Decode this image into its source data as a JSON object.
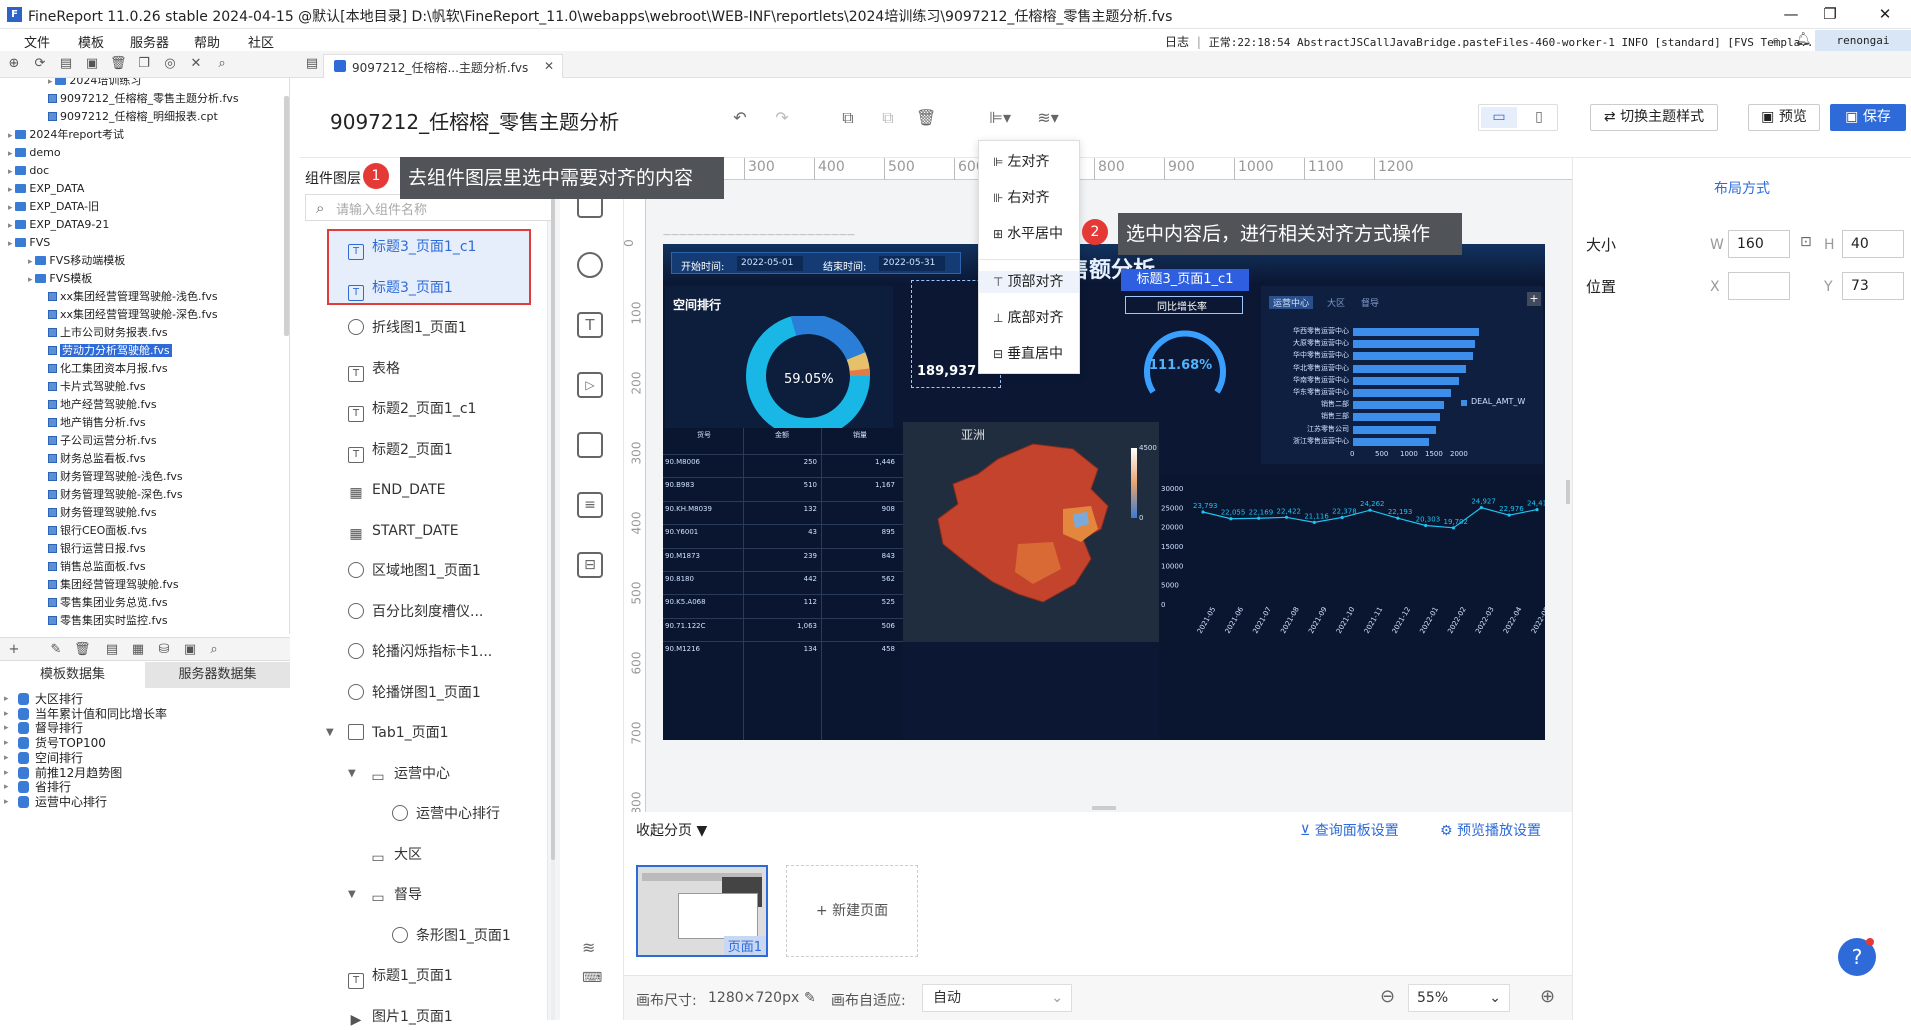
{
  "window": {
    "title": "FineReport 11.0.26 stable 2024-04-15 @默认[本地目录]    D:\\帆软\\FineReport_11.0\\webapps\\webroot\\WEB-INF\\reportlets\\2024培训练习\\9097212_任榕榕_零售主题分析.fvs"
  },
  "menu": [
    "文件",
    "模板",
    "服务器",
    "帮助",
    "社区"
  ],
  "status": {
    "log_label": "日志",
    "text": "正常:22:18:54 AbstractJSCallJavaBridge.pasteFiles-460-worker-1 INFO [standard] [FVS Templa...",
    "user": "renongai"
  },
  "tab": {
    "label": "9097212_任榕榕...主题分析.fvs"
  },
  "file_tree": [
    {
      "label": "2024培训练习",
      "kind": "folder"
    },
    {
      "label": "9097212_任榕榕_零售主题分析.fvs",
      "kind": "file"
    },
    {
      "label": "9097212_任榕榕_明细报表.cpt",
      "kind": "file"
    },
    {
      "label": "2024年report考试",
      "kind": "folder"
    },
    {
      "label": "demo",
      "kind": "folder"
    },
    {
      "label": "doc",
      "kind": "folder"
    },
    {
      "label": "EXP_DATA",
      "kind": "folder"
    },
    {
      "label": "EXP_DATA-旧",
      "kind": "folder"
    },
    {
      "label": "EXP_DATA9-21",
      "kind": "folder"
    },
    {
      "label": "FVS",
      "kind": "folder"
    },
    {
      "label": "FVS移动端模板",
      "kind": "folder"
    },
    {
      "label": "FVS模板",
      "kind": "folder"
    },
    {
      "label": "xx集团经营管理驾驶舱-浅色.fvs",
      "kind": "file"
    },
    {
      "label": "xx集团经营管理驾驶舱-深色.fvs",
      "kind": "file"
    },
    {
      "label": "上市公司财务报表.fvs",
      "kind": "file"
    },
    {
      "label": "劳动力分析驾驶舱.fvs",
      "kind": "file",
      "selected": true
    },
    {
      "label": "化工集团资本月报.fvs",
      "kind": "file"
    },
    {
      "label": "卡片式驾驶舱.fvs",
      "kind": "file"
    },
    {
      "label": "地产经营驾驶舱.fvs",
      "kind": "file"
    },
    {
      "label": "地产销售分析.fvs",
      "kind": "file"
    },
    {
      "label": "子公司运营分析.fvs",
      "kind": "file"
    },
    {
      "label": "财务总监看板.fvs",
      "kind": "file"
    },
    {
      "label": "财务管理驾驶舱-浅色.fvs",
      "kind": "file"
    },
    {
      "label": "财务管理驾驶舱-深色.fvs",
      "kind": "file"
    },
    {
      "label": "财务管理驾驶舱.fvs",
      "kind": "file"
    },
    {
      "label": "银行CEO面板.fvs",
      "kind": "file"
    },
    {
      "label": "银行运营日报.fvs",
      "kind": "file"
    },
    {
      "label": "销售总监面板.fvs",
      "kind": "file"
    },
    {
      "label": "集团经营管理驾驶舱.fvs",
      "kind": "file"
    },
    {
      "label": "零售集团业务总览.fvs",
      "kind": "file"
    },
    {
      "label": "零售集团实时监控.fvs",
      "kind": "file"
    }
  ],
  "dataset_tabs": [
    "模板数据集",
    "服务器数据集"
  ],
  "datasets": [
    "大区排行",
    "当年累计值和同比增长率",
    "督导排行",
    "货号TOP100",
    "空间排行",
    "前推12月趋势图",
    "省排行",
    "运营中心排行"
  ],
  "header": {
    "page_name": "9097212_任榕榕_零售主题分析",
    "switch_theme": "切换主题样式",
    "preview": "预览",
    "save": "保存"
  },
  "layers": {
    "title": "组件图层",
    "search_placeholder": "请输入组件名称",
    "items": [
      {
        "label": "标题3_页面1_c1",
        "icon": "T",
        "indent": 0,
        "selected": true
      },
      {
        "label": "标题3_页面1",
        "icon": "T",
        "indent": 0,
        "selected": true
      },
      {
        "label": "折线图1_页面1",
        "icon": "clock",
        "indent": 0
      },
      {
        "label": "表格",
        "icon": "T",
        "indent": 0
      },
      {
        "label": "标题2_页面1_c1",
        "icon": "T",
        "indent": 0
      },
      {
        "label": "标题2_页面1",
        "icon": "T",
        "indent": 0
      },
      {
        "label": "END_DATE",
        "icon": "grid",
        "indent": 0
      },
      {
        "label": "START_DATE",
        "icon": "grid",
        "indent": 0
      },
      {
        "label": "区域地图1_页面1",
        "icon": "clock",
        "indent": 0
      },
      {
        "label": "百分比刻度槽仪...",
        "icon": "clock",
        "indent": 0
      },
      {
        "label": "轮播闪烁指标卡1...",
        "icon": "clock",
        "indent": 0
      },
      {
        "label": "轮播饼图1_页面1",
        "icon": "clock",
        "indent": 0
      },
      {
        "label": "Tab1_页面1",
        "icon": "tab",
        "indent": 0,
        "caret": true
      },
      {
        "label": "运营中心",
        "icon": "folder",
        "indent": 1,
        "caret": true
      },
      {
        "label": "运营中心排行",
        "icon": "clock",
        "indent": 2
      },
      {
        "label": "大区",
        "icon": "folder",
        "indent": 1
      },
      {
        "label": "督导",
        "icon": "folder",
        "indent": 1,
        "caret": true
      },
      {
        "label": "条形图1_页面1",
        "icon": "clock",
        "indent": 2
      },
      {
        "label": "标题1_页面1",
        "icon": "T",
        "indent": 0
      },
      {
        "label": "图片1_页面1",
        "icon": "img",
        "indent": 0
      }
    ]
  },
  "align_menu": [
    "左对齐",
    "右对齐",
    "水平居中",
    "顶部对齐",
    "底部对齐",
    "垂直居中"
  ],
  "tips": [
    {
      "num": "1",
      "text": "去组件图层里选中需要对齐的内容"
    },
    {
      "num": "2",
      "text": "选中内容后，进行相关对齐方式操作"
    }
  ],
  "ruler_h": [
    "100",
    "200",
    "300",
    "400",
    "500",
    "600",
    "700",
    "800",
    "900",
    "1000",
    "1100",
    "1200"
  ],
  "ruler_v": [
    "0",
    "100",
    "200",
    "300",
    "400",
    "500",
    "600",
    "700",
    "800"
  ],
  "dashboard": {
    "start_label": "开始时间:",
    "start_value": "2022-05-01",
    "end_label": "结束时间:",
    "end_value": "2022-05-31",
    "title_partial": "售额分析",
    "selected_tag": "标题3_页面1_c1",
    "yoy_label": "同比增长率",
    "space_rank": "空间排行",
    "donut_pct": "59.05%",
    "gauge_pct": "111.68%",
    "kpi_value": "189,937",
    "tabs": [
      "运营中心",
      "大区",
      "督导"
    ],
    "table_headers": [
      "货号",
      "金额",
      "销量"
    ],
    "table_rows": [
      [
        "90.M8006",
        "250",
        "1,446"
      ],
      [
        "90.B983",
        "510",
        "1,167"
      ],
      [
        "90.KH.M8039",
        "132",
        "908"
      ],
      [
        "90.Y6001",
        "43",
        "895"
      ],
      [
        "90.M1873",
        "239",
        "843"
      ],
      [
        "90.8180",
        "442",
        "562"
      ],
      [
        "90.K5.A068",
        "112",
        "525"
      ],
      [
        "90.71.122C",
        "1,063",
        "506"
      ],
      [
        "90.M1216",
        "134",
        "458"
      ]
    ],
    "map_label": "亚洲",
    "map_legend_max": "4500",
    "map_legend_min": "0",
    "bar_legend": "DEAL_AMT_W",
    "bar_categories": [
      "华西零售运营中心",
      "大原零售运营中心",
      "华中零售运营中心",
      "华北零售运营中心",
      "华南零售运营中心",
      "华东零售运营中心",
      "销售二部",
      "销售三部",
      "江苏零售公司",
      "浙江零售运营中心"
    ],
    "bar_values": [
      1450,
      1400,
      1380,
      1300,
      1220,
      1130,
      1050,
      1000,
      960,
      870
    ],
    "bar_ticks": [
      "0",
      "500",
      "1000",
      "1500",
      "2000"
    ],
    "line_yticks": [
      "30000",
      "25000",
      "20000",
      "15000",
      "10000",
      "5000",
      "0"
    ],
    "line_labels": [
      "23,793",
      "22,055",
      "22,169",
      "22,422",
      "21,116",
      "22,378",
      "24,262",
      "22,193",
      "20,303",
      "19,702",
      "24,927",
      "22,976",
      "24,418"
    ],
    "line_x": [
      "2021-05",
      "2021-06",
      "2021-07",
      "2021-08",
      "2021-09",
      "2021-10",
      "2021-11",
      "2021-12",
      "2022-01",
      "2022-02",
      "2022-03",
      "2022-04",
      "2022-05"
    ]
  },
  "right_panel": {
    "layout_mode": "布局方式",
    "size_label": "大小",
    "w_label": "W",
    "w_value": "160",
    "h_label": "H",
    "h_value": "40",
    "pos_label": "位置",
    "x_label": "X",
    "x_value": "",
    "y_label": "Y",
    "y_value": "73"
  },
  "bottom": {
    "collapse": "收起分页",
    "query_panel": "查询面板设置",
    "preview_play": "预览播放设置",
    "page1": "页面1",
    "new_page": "+ 新建页面",
    "canvas_size_label": "画布尺寸:",
    "canvas_size": "1280×720px",
    "adapt_label": "画布自适应:",
    "adapt_value": "自动",
    "zoom": "55%"
  },
  "colors": {
    "accent": "#2e6bd8",
    "dash_bg": "#0b1733",
    "bar": "#3d8eea",
    "map_red": "#c4432c",
    "tip_bg": "#505357"
  }
}
